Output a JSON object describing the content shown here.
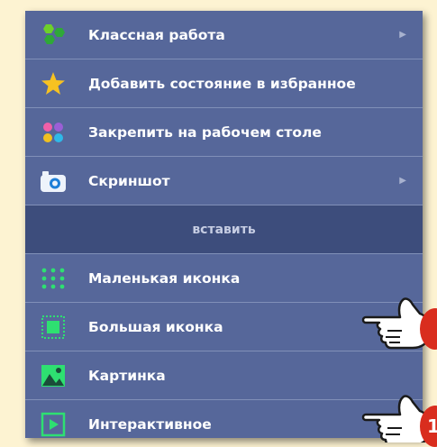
{
  "menu": {
    "items": [
      {
        "label": "Классная работа",
        "icon": "green-hexagons-icon",
        "submenu": true
      },
      {
        "label": "Добавить состояние в избранное",
        "icon": "star-icon",
        "submenu": false
      },
      {
        "label": "Закрепить на рабочем столе",
        "icon": "colored-dots-icon",
        "submenu": false
      },
      {
        "label": "Скриншот",
        "icon": "camera-icon",
        "submenu": true
      }
    ],
    "section_label": "вставить",
    "insert_items": [
      {
        "label": "Маленькая иконка",
        "icon": "small-icon-grid-icon"
      },
      {
        "label": "Большая иконка",
        "icon": "large-icon-frame-icon"
      },
      {
        "label": "Картинка",
        "icon": "picture-icon"
      },
      {
        "label": "Интерактивное",
        "icon": "play-icon"
      }
    ],
    "arrow_glyph": "▶"
  },
  "colors": {
    "background": "#fdf3d2",
    "menu": "#56679a",
    "section": "#3d4d7c",
    "accent_green": "#2ee071",
    "badge_red": "#d92d1e"
  },
  "badges": [
    "",
    "1"
  ]
}
